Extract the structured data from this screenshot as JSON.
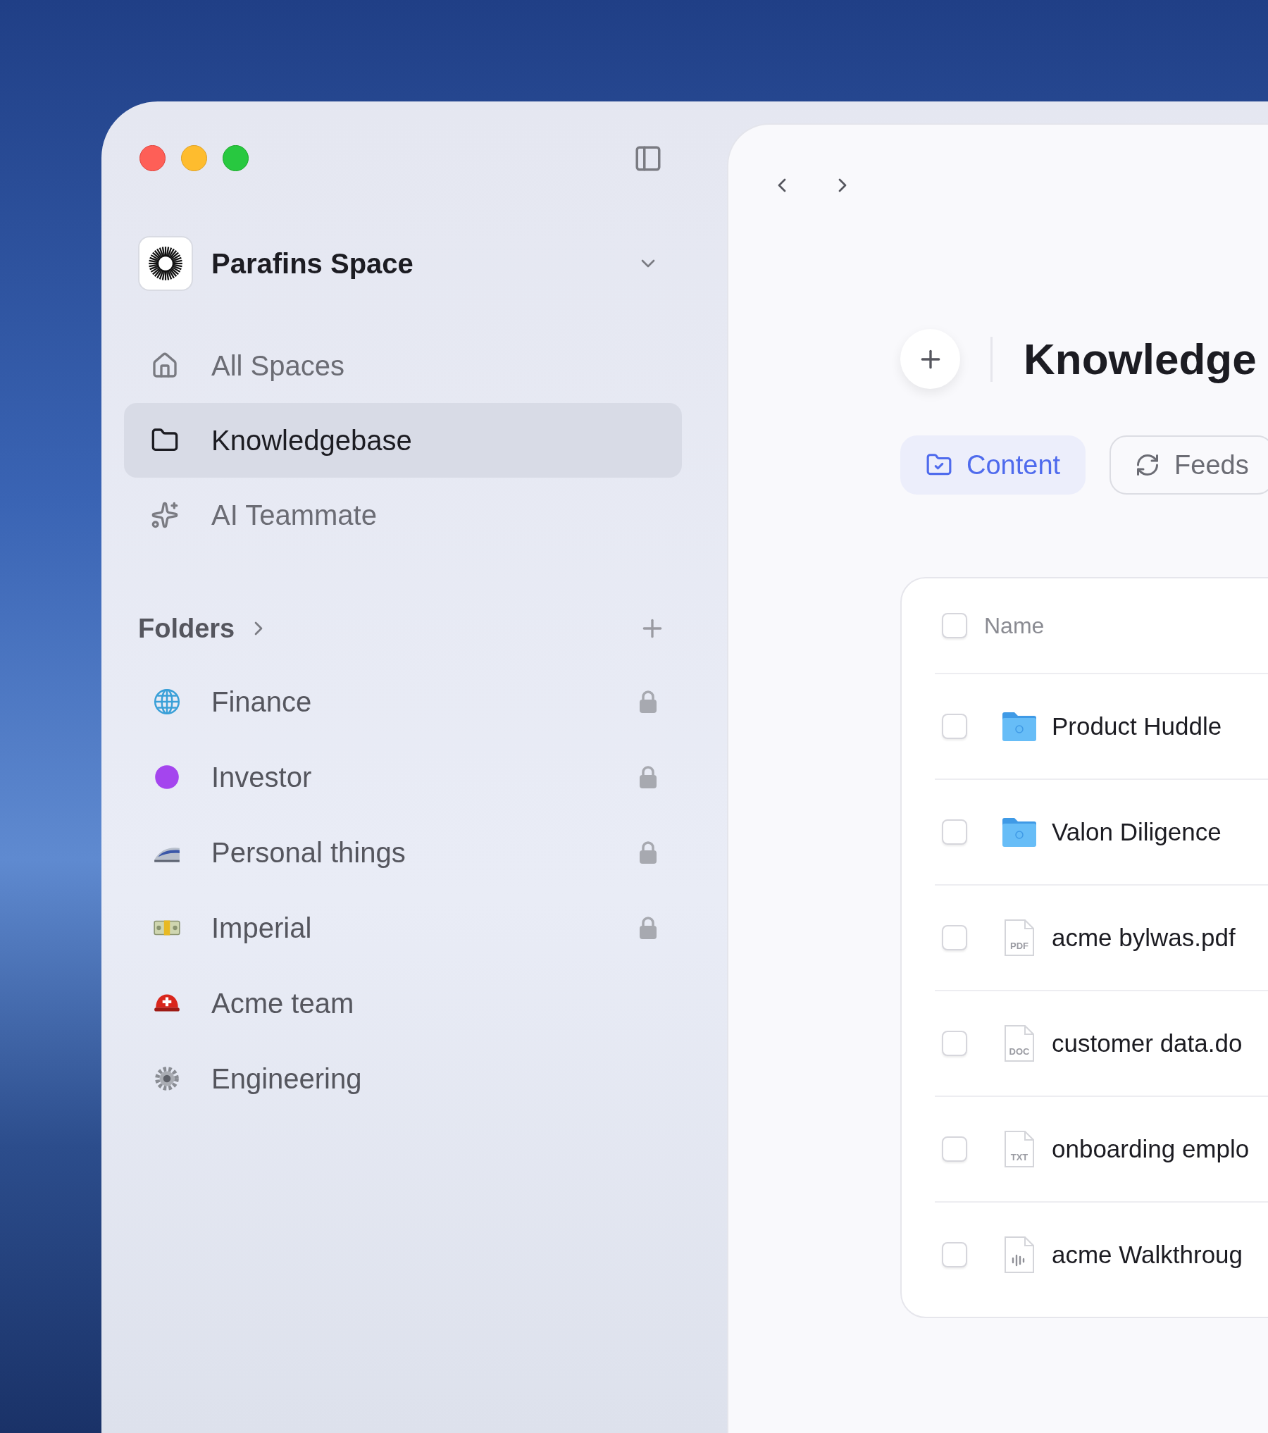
{
  "workspace": {
    "name": "Parafins Space"
  },
  "nav": [
    {
      "label": "All Spaces",
      "kind": "home",
      "selected": false
    },
    {
      "label": "Knowledgebase",
      "kind": "folder",
      "selected": true
    },
    {
      "label": "AI Teammate",
      "kind": "sparkles",
      "selected": false
    }
  ],
  "folders": {
    "title": "Folders",
    "items": [
      {
        "label": "Finance",
        "kind": "globe",
        "locked": true
      },
      {
        "label": "Investor",
        "kind": "dot",
        "locked": true
      },
      {
        "label": "Personal things",
        "kind": "train",
        "locked": true
      },
      {
        "label": "Imperial",
        "kind": "money",
        "locked": true
      },
      {
        "label": "Acme team",
        "kind": "helmet",
        "locked": false
      },
      {
        "label": "Engineering",
        "kind": "gear",
        "locked": false
      }
    ]
  },
  "main": {
    "title": "Knowledge",
    "tabs": [
      {
        "label": "Content",
        "kind": "content",
        "selected": true
      },
      {
        "label": "Feeds",
        "kind": "feeds",
        "selected": false
      }
    ],
    "table": {
      "columns": [
        "Name"
      ],
      "all_checked": false,
      "rows": [
        {
          "name": "Product Huddle",
          "kind": "folder",
          "checked": false
        },
        {
          "name": "Valon Diligence",
          "kind": "folder",
          "checked": false
        },
        {
          "name": "acme bylwas.pdf",
          "kind": "file",
          "badge": "PDF",
          "checked": false
        },
        {
          "name": "customer data.do",
          "kind": "file",
          "badge": "DOC",
          "checked": false
        },
        {
          "name": "onboarding emplo",
          "kind": "file",
          "badge": "TXT",
          "checked": false
        },
        {
          "name": "acme Walkthroug",
          "kind": "audio",
          "checked": false
        }
      ]
    }
  }
}
